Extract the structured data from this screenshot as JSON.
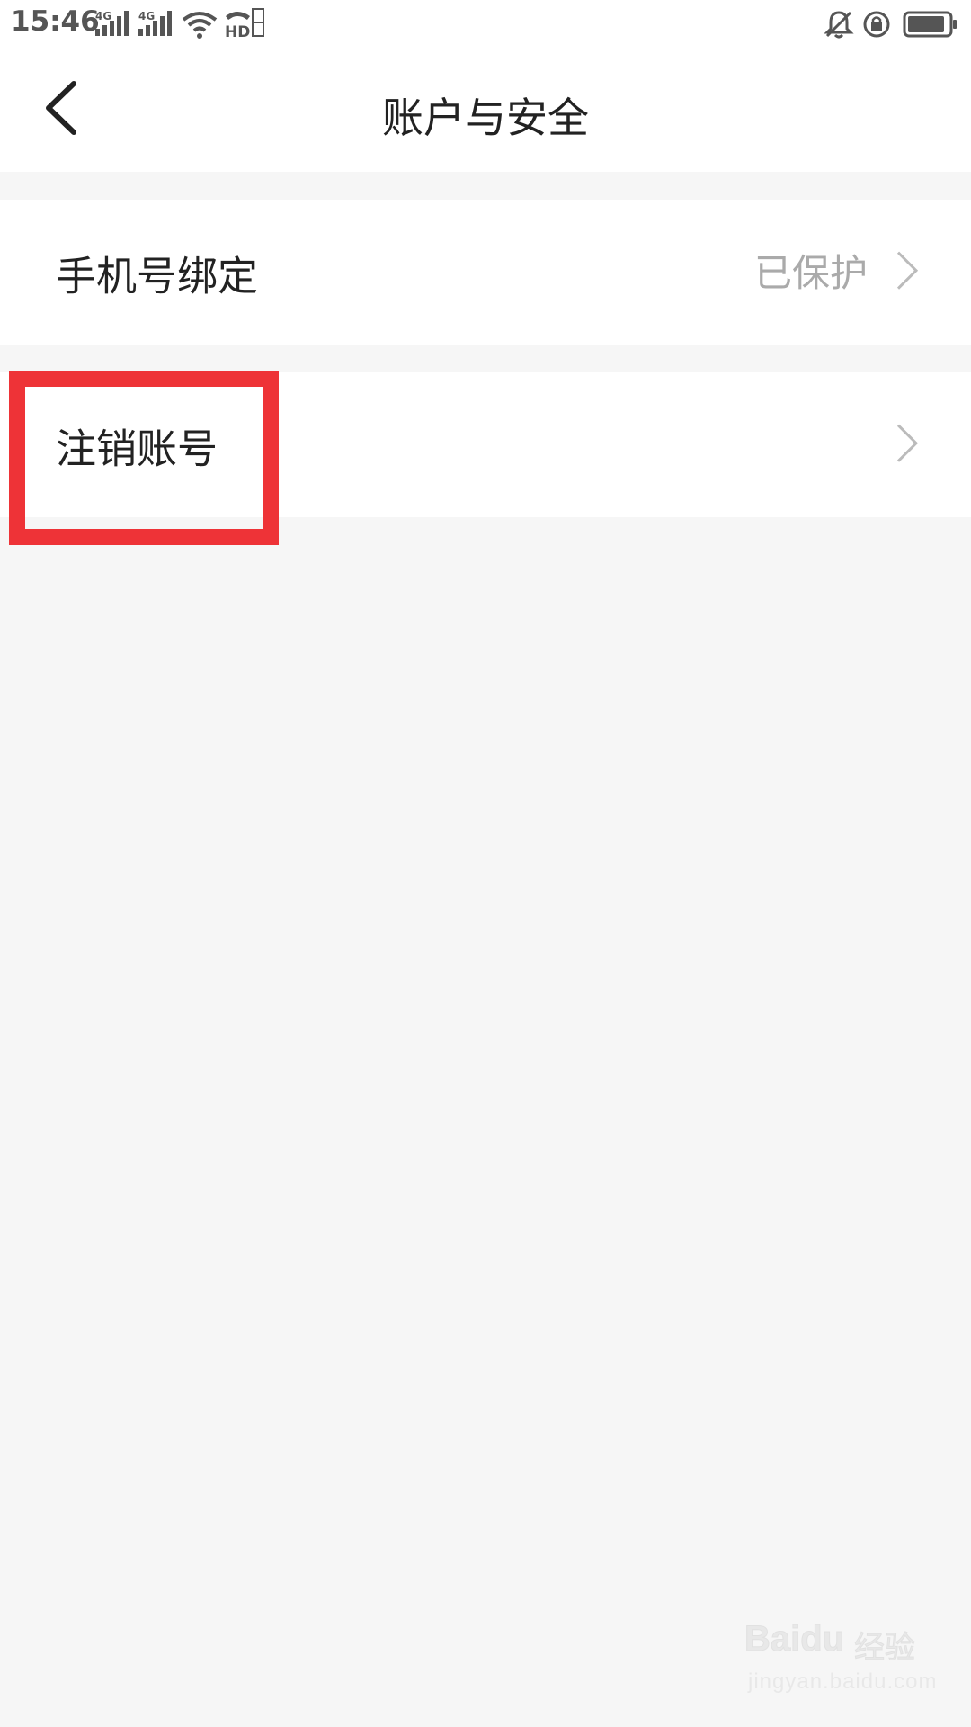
{
  "status_bar": {
    "time": "15:46",
    "network_1": "4G",
    "network_2": "4G",
    "hd_label": "HD",
    "icons": [
      "signal-4g-icon",
      "signal-4g-icon",
      "wifi-icon",
      "hd-call-icon",
      "mute-bell-icon",
      "rotation-lock-icon",
      "battery-icon"
    ]
  },
  "header": {
    "title": "账户与安全",
    "back_icon": "chevron-left-icon"
  },
  "rows": [
    {
      "label": "手机号绑定",
      "value": "已保护",
      "icon": "chevron-right-icon"
    },
    {
      "label": "注销账号",
      "value": "",
      "icon": "chevron-right-icon"
    }
  ],
  "annotation": {
    "highlight_color": "#ee3337"
  },
  "watermark": {
    "brand": "Baidu",
    "cn": "经验",
    "url": "jingyan.baidu.com"
  },
  "colors": {
    "background": "#f6f6f6",
    "surface": "#ffffff",
    "text_primary": "#222222",
    "text_secondary": "#aaaaaa"
  }
}
